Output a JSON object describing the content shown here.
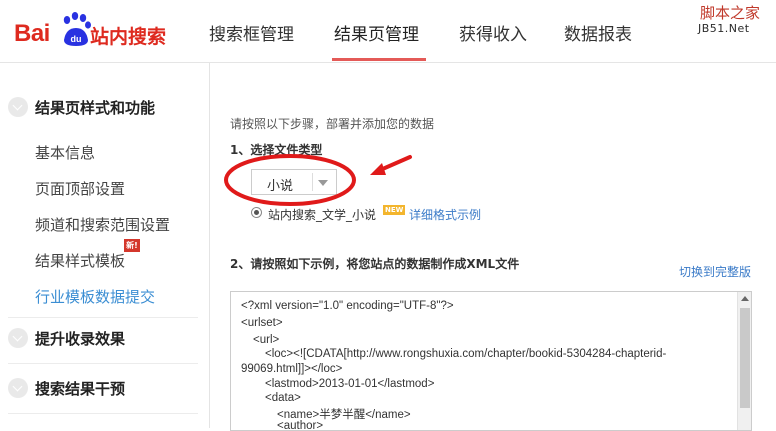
{
  "logo": {
    "bai": "Bai",
    "du": "du",
    "text": "站内搜索"
  },
  "nav": {
    "tabs": [
      {
        "label": "搜索框管理"
      },
      {
        "label": "结果页管理"
      },
      {
        "label": "获得收入"
      },
      {
        "label": "数据报表"
      }
    ],
    "active_index": 1
  },
  "watermark": {
    "main": "脚本之家",
    "sub": "JB51.Net"
  },
  "sidebar": {
    "section1": "结果页样式和功能",
    "items": [
      "基本信息",
      "页面顶部设置",
      "频道和搜索范围设置",
      "结果样式模板",
      "行业模板数据提交"
    ],
    "active_item": 4,
    "new_badge": "新!",
    "section2": "提升收录效果",
    "section3": "搜索结果干预"
  },
  "main": {
    "intro": "请按照以下步骤，部署并添加您的数据",
    "step1_title": "1、选择文件类型",
    "file_type": "小说",
    "radio_label": "站内搜索_文学_小说",
    "new_tag": "NEW",
    "format_link": "详细格式示例",
    "step2_title": "2、请按照如下示例，将您站点的数据制作成XML文件",
    "switch_link": "切换到完整版",
    "code_lines": [
      "<?xml version=\"1.0\" encoding=\"UTF-8\"?>",
      "<urlset>",
      "<url>",
      "<loc><![CDATA[http://www.rongshuxia.com/chapter/bookid-5304284-chapterid-",
      "99069.html]]></loc>",
      "<lastmod>2013-01-01</lastmod>",
      "<data>",
      "<name>半梦半醒</name>",
      "<author>"
    ]
  },
  "colors": {
    "brand_red": "#de2a1f",
    "link_blue": "#3b7bc8",
    "annotation_red": "#e01a1a"
  }
}
